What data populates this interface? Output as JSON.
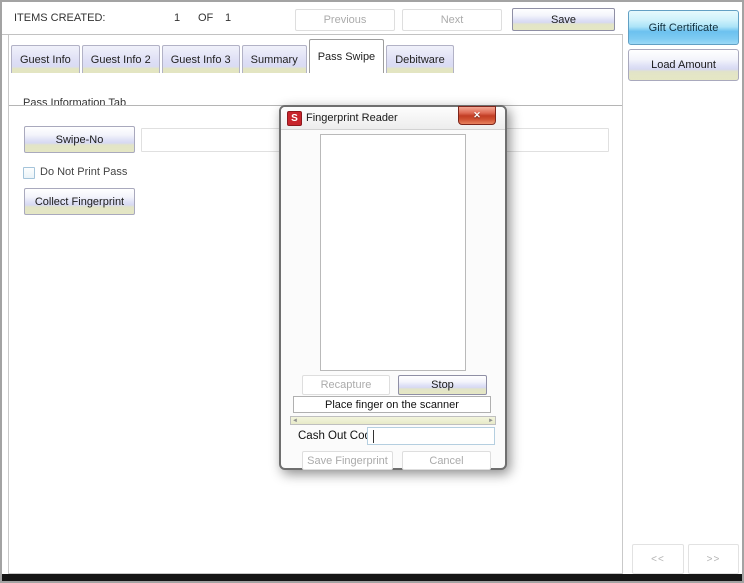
{
  "topbar": {
    "items_created_label": "ITEMS CREATED:",
    "current_item": "1",
    "of_label": "OF",
    "total_items": "1",
    "previous_label": "Previous",
    "next_label": "Next",
    "save_label": "Save"
  },
  "tabs": [
    {
      "label": "Guest Info",
      "active": false
    },
    {
      "label": "Guest Info 2",
      "active": false
    },
    {
      "label": "Guest Info 3",
      "active": false
    },
    {
      "label": "Summary",
      "active": false
    },
    {
      "label": "Pass Swipe",
      "active": true
    },
    {
      "label": "Debitware",
      "active": false
    }
  ],
  "pass_tab": {
    "section_label": "Pass Information Tab",
    "swipe_button_label": "Swipe-No",
    "swipe_field_value": "",
    "do_not_print_label": "Do Not Print Pass",
    "do_not_print_checked": false,
    "collect_fingerprint_label": "Collect Fingerprint"
  },
  "fingerprint_dialog": {
    "title": "Fingerprint Reader",
    "app_icon_letter": "S",
    "close_glyph": "✕",
    "recapture_label": "Recapture",
    "stop_label": "Stop",
    "status_message": "Place finger on the scanner",
    "cash_out_code_label": "Cash Out Code:",
    "cash_out_code_value": "",
    "save_fingerprint_label": "Save Fingerprint",
    "cancel_label": "Cancel"
  },
  "sidebar": {
    "gift_certificate_label": "Gift Certificate",
    "load_amount_label": "Load Amount",
    "scroll_prev_label": "<<",
    "scroll_next_label": ">>"
  },
  "icons": {
    "scroll_left_arrow": "◄",
    "scroll_right_arrow": "►"
  },
  "colors": {
    "accent_blue": "#7ec9f2",
    "button_lavender": "#d9dbf3",
    "button_khaki": "#e5e7c4",
    "close_red": "#c23d24",
    "app_icon_red": "#c8242b"
  }
}
